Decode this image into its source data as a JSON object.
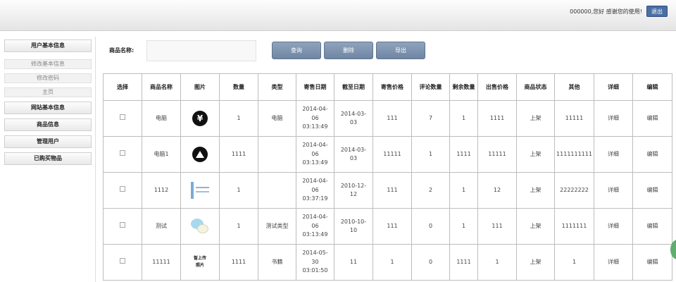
{
  "header": {
    "welcome": "000000,您好 感谢您的使用!",
    "logout": "退出"
  },
  "sidebar": {
    "items": [
      {
        "label": "用户基本信息",
        "type": "main"
      },
      {
        "label": "修改基本信息",
        "type": "sub"
      },
      {
        "label": "修改密码",
        "type": "sub"
      },
      {
        "label": "主页",
        "type": "sub"
      },
      {
        "label": "网站基本信息",
        "type": "main"
      },
      {
        "label": "商品信息",
        "type": "main"
      },
      {
        "label": "管理用户",
        "type": "main"
      },
      {
        "label": "已购买物品",
        "type": "main"
      }
    ]
  },
  "search": {
    "label": "商品名称:",
    "value": "",
    "placeholder": ""
  },
  "buttons": {
    "query": "查询",
    "delete": "删除",
    "export": "导出"
  },
  "table": {
    "headers": [
      "选择",
      "商品名称",
      "图片",
      "数量",
      "类型",
      "寄售日期",
      "截至日期",
      "寄售价格",
      "评论数量",
      "剩余数量",
      "出售价格",
      "商品状态",
      "其他",
      "详细",
      "编辑"
    ],
    "rows": [
      {
        "name": "电脑",
        "image": "yen-icon",
        "qty": "1",
        "type": "电脑",
        "sale_date": [
          "2014-04-",
          "06",
          "03:13:49"
        ],
        "end_date": [
          "2014-03-",
          "03"
        ],
        "price": "111",
        "comments": "7",
        "remaining": "1",
        "sell_price": "1111",
        "status": "上架",
        "other": "11111",
        "detail": "详细",
        "edit": "编辑"
      },
      {
        "name": "电脑1",
        "image": "warning-icon",
        "qty": "1111",
        "type": "",
        "sale_date": [
          "2014-04-",
          "06",
          "03:13:49"
        ],
        "end_date": [
          "2014-03-",
          "03"
        ],
        "price": "11111",
        "comments": "1",
        "remaining": "1111",
        "sell_price": "11111",
        "status": "上架",
        "other": "1111111111",
        "detail": "详细",
        "edit": "编辑"
      },
      {
        "name": "1112",
        "image": "qr-thumb",
        "qty": "1",
        "type": "",
        "sale_date": [
          "2014-04-",
          "06",
          "03:37:19"
        ],
        "end_date": [
          "2010-12-",
          "12"
        ],
        "price": "111",
        "comments": "2",
        "remaining": "1",
        "sell_price": "12",
        "status": "上架",
        "other": "22222222",
        "detail": "详细",
        "edit": "编辑"
      },
      {
        "name": "测试",
        "image": "chat-bubble-icon",
        "qty": "1",
        "type": "测试类型",
        "sale_date": [
          "2014-04-",
          "06",
          "03:13:49"
        ],
        "end_date": [
          "2010-10-",
          "10"
        ],
        "price": "111",
        "comments": "0",
        "remaining": "1",
        "sell_price": "111",
        "status": "上架",
        "other": "1111111",
        "detail": "详细",
        "edit": "编辑"
      },
      {
        "name": "11111",
        "image": "text-thumb",
        "image_text": [
          "暂上传",
          "照片"
        ],
        "qty": "1111",
        "type": "书籍",
        "sale_date": [
          "2014-05-",
          "30",
          "03:01:50"
        ],
        "end_date": [],
        "price": "11",
        "comments": "1",
        "remaining": "0",
        "sell_price": "1111",
        "status": "1",
        "other": "上架",
        "detail": "1",
        "edit": "详细",
        "extra_edit": "编辑"
      }
    ]
  }
}
